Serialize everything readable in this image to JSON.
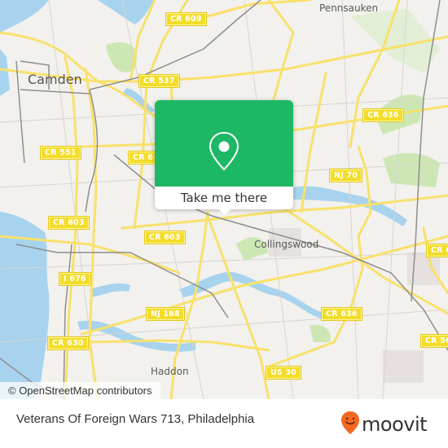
{
  "map": {
    "places": [
      {
        "id": "camden",
        "label": "Camden"
      },
      {
        "id": "pennsauken",
        "label": "Pennsauken"
      },
      {
        "id": "collingswood",
        "label": "Collingswood"
      },
      {
        "id": "haddon",
        "label": "Haddon"
      }
    ],
    "road_shields": [
      {
        "id": "cr609",
        "label": "CR 609"
      },
      {
        "id": "cr537",
        "label": "CR 537"
      },
      {
        "id": "cr636-top",
        "label": "CR 636"
      },
      {
        "id": "cr551",
        "label": "CR 551"
      },
      {
        "id": "cr6xx",
        "label": "CR 6"
      },
      {
        "id": "nj70",
        "label": "NJ 70"
      },
      {
        "id": "cr603-left",
        "label": "CR 603"
      },
      {
        "id": "cr603-mid",
        "label": "CR 603"
      },
      {
        "id": "i676",
        "label": "I 676"
      },
      {
        "id": "nj168",
        "label": "NJ 168"
      },
      {
        "id": "cr630",
        "label": "CR 630"
      },
      {
        "id": "cr636-bottom",
        "label": "CR 636"
      },
      {
        "id": "us30",
        "label": "US 30"
      },
      {
        "id": "cr6-right",
        "label": "CR 6"
      },
      {
        "id": "cr56-right",
        "label": "CR 56"
      }
    ],
    "attribution": "© OpenStreetMap contributors"
  },
  "popup": {
    "icon": "location-pin-icon",
    "button_label": "Take me there",
    "color": "#1db866"
  },
  "footer": {
    "title": "Veterans Of Foreign Wars 713, Philadelphia",
    "brand": "moovit",
    "brand_icon": "moovit-smiley-pin-icon",
    "brand_color": "#f26722"
  }
}
